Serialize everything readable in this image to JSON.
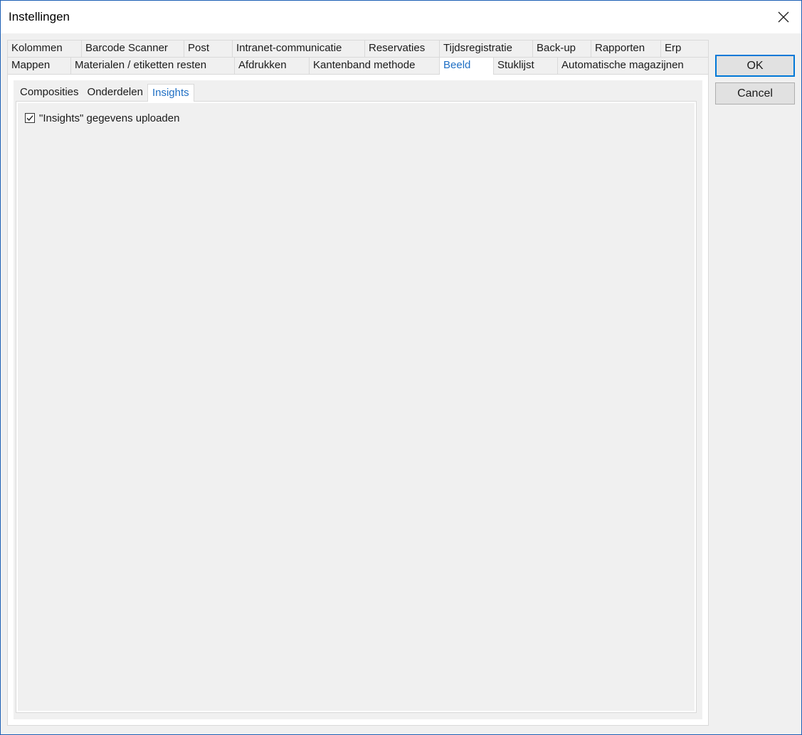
{
  "window": {
    "title": "Instellingen"
  },
  "tabs": {
    "row1": [
      "Kolommen",
      "Barcode Scanner",
      "Post",
      "Intranet-communicatie",
      "Reservaties",
      "Tijdsregistratie",
      "Back-up",
      "Rapporten",
      "Erp"
    ],
    "row2": [
      "Mappen",
      "Materialen / etiketten resten",
      "Afdrukken",
      "Kantenband methode",
      "Beeld",
      "Stuklijst",
      "Automatische magazijnen"
    ],
    "active": "Beeld"
  },
  "subtabs": {
    "items": [
      "Composities",
      "Onderdelen",
      "Insights"
    ],
    "active": "Insights"
  },
  "insights": {
    "upload_label": "\"Insights\" gegevens uploaden",
    "upload_checked": true
  },
  "buttons": {
    "ok": "OK",
    "cancel": "Cancel"
  },
  "colors": {
    "accent": "#1f6fc4",
    "border": "#1c5fb5"
  }
}
